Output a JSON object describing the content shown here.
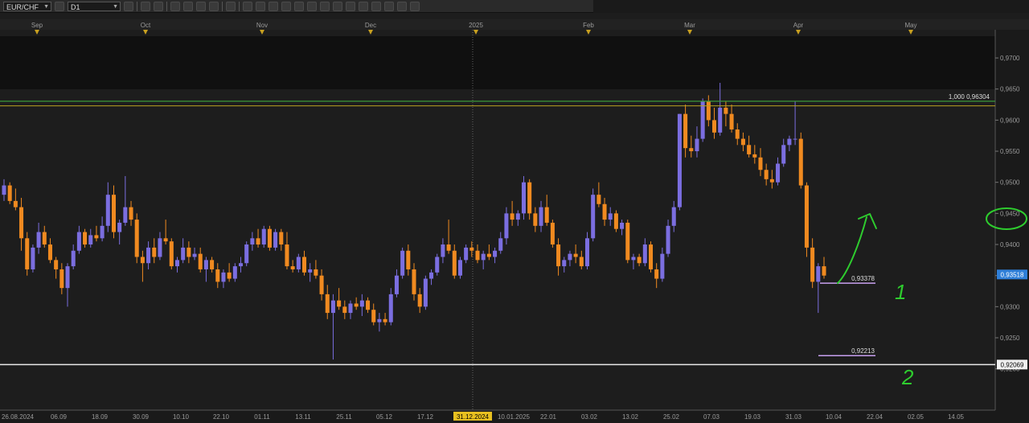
{
  "toolbar": {
    "symbol": "EUR/CHF",
    "timeframe": "D1",
    "buttons": [
      "chart-type",
      "indicators",
      "crosshair",
      "zoom-in",
      "zoom-out",
      "draw",
      "text",
      "shapes",
      "fib",
      "trend",
      "channel",
      "levels",
      "settings",
      "erase"
    ]
  },
  "chart_data": {
    "type": "candlestick",
    "instrument": "EUR/CHF",
    "timeframe": "D1",
    "y_range": [
      0.9175,
      0.9735
    ],
    "price_ticks": [
      "0,9700",
      "0,9650",
      "0,9600",
      "0,9550",
      "0,9500",
      "0,9450",
      "0,9400",
      "0,9350",
      "0,9300",
      "0,9250",
      "0,9200"
    ],
    "month_labels": [
      "Sep",
      "Oct",
      "Nov",
      "Dec",
      "2025",
      "Feb",
      "Mar",
      "Apr",
      "May"
    ],
    "date_labels": [
      "26.08.2024",
      "06.09",
      "18.09",
      "30.09",
      "10.10",
      "22.10",
      "01.11",
      "13.11",
      "25.11",
      "05.12",
      "17.12",
      "31.12.2024",
      "10.01.2025",
      "22.01",
      "03.02",
      "13.02",
      "25.02",
      "07.03",
      "19.03",
      "31.03",
      "10.04",
      "22.04",
      "02.05",
      "14.05"
    ],
    "current_date_label": "31.12.2024",
    "current_price": "0,93518",
    "levels": [
      {
        "label": "1,000 0,96304",
        "value": 0.96304,
        "color": "#3a9a3a"
      },
      {
        "label": "0,92069",
        "value": 0.92069,
        "color": "#e8e8e8"
      }
    ],
    "ochl_note": "candles: [open, high, low, close]",
    "candles": [
      [
        0.948,
        0.9505,
        0.947,
        0.9495
      ],
      [
        0.9495,
        0.95,
        0.9465,
        0.947
      ],
      [
        0.947,
        0.949,
        0.9455,
        0.946
      ],
      [
        0.946,
        0.9475,
        0.939,
        0.941
      ],
      [
        0.941,
        0.942,
        0.935,
        0.936
      ],
      [
        0.936,
        0.94,
        0.9355,
        0.9395
      ],
      [
        0.9395,
        0.9435,
        0.9385,
        0.942
      ],
      [
        0.942,
        0.943,
        0.9395,
        0.94
      ],
      [
        0.94,
        0.941,
        0.937,
        0.9375
      ],
      [
        0.9375,
        0.938,
        0.9345,
        0.936
      ],
      [
        0.936,
        0.937,
        0.932,
        0.933
      ],
      [
        0.933,
        0.937,
        0.93,
        0.9365
      ],
      [
        0.9365,
        0.94,
        0.936,
        0.939
      ],
      [
        0.939,
        0.943,
        0.9385,
        0.942
      ],
      [
        0.942,
        0.9425,
        0.9395,
        0.94
      ],
      [
        0.94,
        0.9425,
        0.9395,
        0.9415
      ],
      [
        0.9415,
        0.943,
        0.9405,
        0.941
      ],
      [
        0.941,
        0.9445,
        0.9405,
        0.943
      ],
      [
        0.943,
        0.95,
        0.942,
        0.948
      ],
      [
        0.948,
        0.9495,
        0.941,
        0.942
      ],
      [
        0.942,
        0.944,
        0.94,
        0.9435
      ],
      [
        0.9435,
        0.951,
        0.943,
        0.946
      ],
      [
        0.946,
        0.947,
        0.943,
        0.944
      ],
      [
        0.944,
        0.945,
        0.937,
        0.938
      ],
      [
        0.938,
        0.939,
        0.934,
        0.937
      ],
      [
        0.937,
        0.9405,
        0.936,
        0.9395
      ],
      [
        0.9395,
        0.941,
        0.937,
        0.938
      ],
      [
        0.938,
        0.942,
        0.9375,
        0.941
      ],
      [
        0.941,
        0.944,
        0.94,
        0.9405
      ],
      [
        0.9405,
        0.941,
        0.936,
        0.9365
      ],
      [
        0.9365,
        0.938,
        0.9355,
        0.9375
      ],
      [
        0.9375,
        0.941,
        0.937,
        0.9395
      ],
      [
        0.9395,
        0.9405,
        0.937,
        0.938
      ],
      [
        0.938,
        0.9395,
        0.9375,
        0.9385
      ],
      [
        0.9385,
        0.9395,
        0.9355,
        0.936
      ],
      [
        0.936,
        0.938,
        0.934,
        0.9375
      ],
      [
        0.9375,
        0.938,
        0.9355,
        0.936
      ],
      [
        0.936,
        0.937,
        0.933,
        0.934
      ],
      [
        0.934,
        0.936,
        0.933,
        0.9355
      ],
      [
        0.9355,
        0.937,
        0.934,
        0.9345
      ],
      [
        0.9345,
        0.937,
        0.934,
        0.9365
      ],
      [
        0.9365,
        0.938,
        0.9355,
        0.937
      ],
      [
        0.937,
        0.9405,
        0.9365,
        0.94
      ],
      [
        0.94,
        0.942,
        0.939,
        0.941
      ],
      [
        0.941,
        0.9425,
        0.9395,
        0.94
      ],
      [
        0.94,
        0.943,
        0.9395,
        0.9425
      ],
      [
        0.9425,
        0.943,
        0.939,
        0.9395
      ],
      [
        0.9395,
        0.9425,
        0.939,
        0.942
      ],
      [
        0.942,
        0.9425,
        0.939,
        0.94
      ],
      [
        0.94,
        0.942,
        0.936,
        0.9365
      ],
      [
        0.9365,
        0.9375,
        0.9355,
        0.936
      ],
      [
        0.936,
        0.9385,
        0.9355,
        0.938
      ],
      [
        0.938,
        0.939,
        0.935,
        0.9355
      ],
      [
        0.9355,
        0.937,
        0.934,
        0.936
      ],
      [
        0.936,
        0.9375,
        0.9345,
        0.935
      ],
      [
        0.935,
        0.936,
        0.931,
        0.932
      ],
      [
        0.932,
        0.9335,
        0.928,
        0.929
      ],
      [
        0.929,
        0.932,
        0.9215,
        0.931
      ],
      [
        0.931,
        0.933,
        0.9295,
        0.93
      ],
      [
        0.93,
        0.931,
        0.928,
        0.929
      ],
      [
        0.929,
        0.931,
        0.928,
        0.9305
      ],
      [
        0.9305,
        0.9315,
        0.9295,
        0.93
      ],
      [
        0.93,
        0.932,
        0.9285,
        0.931
      ],
      [
        0.931,
        0.9315,
        0.929,
        0.9295
      ],
      [
        0.9295,
        0.9305,
        0.927,
        0.9275
      ],
      [
        0.9275,
        0.929,
        0.926,
        0.928
      ],
      [
        0.928,
        0.929,
        0.927,
        0.9275
      ],
      [
        0.9275,
        0.933,
        0.927,
        0.932
      ],
      [
        0.932,
        0.936,
        0.9315,
        0.935
      ],
      [
        0.935,
        0.9395,
        0.9345,
        0.939
      ],
      [
        0.939,
        0.94,
        0.935,
        0.936
      ],
      [
        0.936,
        0.937,
        0.931,
        0.932
      ],
      [
        0.932,
        0.933,
        0.929,
        0.93
      ],
      [
        0.93,
        0.935,
        0.9295,
        0.9345
      ],
      [
        0.9345,
        0.936,
        0.9335,
        0.9355
      ],
      [
        0.9355,
        0.9385,
        0.935,
        0.938
      ],
      [
        0.938,
        0.941,
        0.937,
        0.94
      ],
      [
        0.94,
        0.944,
        0.9385,
        0.939
      ],
      [
        0.939,
        0.94,
        0.9345,
        0.935
      ],
      [
        0.935,
        0.938,
        0.9345,
        0.9375
      ],
      [
        0.9375,
        0.94,
        0.937,
        0.9395
      ],
      [
        0.9395,
        0.9405,
        0.938,
        0.939
      ],
      [
        0.939,
        0.94,
        0.937,
        0.9375
      ],
      [
        0.9375,
        0.939,
        0.936,
        0.9385
      ],
      [
        0.9385,
        0.94,
        0.9375,
        0.938
      ],
      [
        0.938,
        0.9395,
        0.937,
        0.939
      ],
      [
        0.939,
        0.942,
        0.9385,
        0.941
      ],
      [
        0.941,
        0.946,
        0.94,
        0.945
      ],
      [
        0.945,
        0.947,
        0.943,
        0.944
      ],
      [
        0.944,
        0.9455,
        0.943,
        0.945
      ],
      [
        0.945,
        0.951,
        0.944,
        0.95
      ],
      [
        0.95,
        0.9505,
        0.944,
        0.945
      ],
      [
        0.945,
        0.946,
        0.942,
        0.943
      ],
      [
        0.943,
        0.947,
        0.942,
        0.946
      ],
      [
        0.946,
        0.948,
        0.943,
        0.9435
      ],
      [
        0.9435,
        0.944,
        0.9395,
        0.94
      ],
      [
        0.94,
        0.941,
        0.935,
        0.9365
      ],
      [
        0.9365,
        0.938,
        0.9355,
        0.9375
      ],
      [
        0.9375,
        0.939,
        0.9365,
        0.9385
      ],
      [
        0.9385,
        0.94,
        0.937,
        0.938
      ],
      [
        0.938,
        0.939,
        0.936,
        0.9365
      ],
      [
        0.9365,
        0.942,
        0.936,
        0.941
      ],
      [
        0.941,
        0.949,
        0.9405,
        0.948
      ],
      [
        0.948,
        0.95,
        0.946,
        0.9465
      ],
      [
        0.9465,
        0.9475,
        0.943,
        0.944
      ],
      [
        0.944,
        0.946,
        0.943,
        0.945
      ],
      [
        0.945,
        0.9455,
        0.942,
        0.9425
      ],
      [
        0.9425,
        0.944,
        0.9415,
        0.9435
      ],
      [
        0.9435,
        0.944,
        0.937,
        0.9375
      ],
      [
        0.9375,
        0.9385,
        0.936,
        0.938
      ],
      [
        0.938,
        0.9385,
        0.9365,
        0.937
      ],
      [
        0.937,
        0.941,
        0.9365,
        0.94
      ],
      [
        0.94,
        0.9405,
        0.9355,
        0.936
      ],
      [
        0.936,
        0.937,
        0.933,
        0.9345
      ],
      [
        0.9345,
        0.9395,
        0.934,
        0.9385
      ],
      [
        0.9385,
        0.944,
        0.938,
        0.943
      ],
      [
        0.943,
        0.947,
        0.942,
        0.946
      ],
      [
        0.946,
        0.961,
        0.9455,
        0.961
      ],
      [
        0.961,
        0.9625,
        0.954,
        0.9555
      ],
      [
        0.9555,
        0.9575,
        0.954,
        0.955
      ],
      [
        0.955,
        0.959,
        0.954,
        0.957
      ],
      [
        0.957,
        0.9635,
        0.9565,
        0.963
      ],
      [
        0.963,
        0.964,
        0.959,
        0.96
      ],
      [
        0.96,
        0.962,
        0.957,
        0.958
      ],
      [
        0.958,
        0.966,
        0.9575,
        0.962
      ],
      [
        0.962,
        0.963,
        0.959,
        0.961
      ],
      [
        0.961,
        0.9625,
        0.958,
        0.9585
      ],
      [
        0.9585,
        0.9595,
        0.956,
        0.957
      ],
      [
        0.957,
        0.958,
        0.955,
        0.956
      ],
      [
        0.956,
        0.9575,
        0.954,
        0.9545
      ],
      [
        0.9545,
        0.956,
        0.953,
        0.954
      ],
      [
        0.954,
        0.9555,
        0.951,
        0.952
      ],
      [
        0.952,
        0.953,
        0.9495,
        0.9505
      ],
      [
        0.9505,
        0.952,
        0.949,
        0.95
      ],
      [
        0.95,
        0.954,
        0.9495,
        0.953
      ],
      [
        0.953,
        0.957,
        0.9525,
        0.956
      ],
      [
        0.956,
        0.9575,
        0.955,
        0.957
      ],
      [
        0.957,
        0.963,
        0.956,
        0.957
      ],
      [
        0.957,
        0.958,
        0.949,
        0.9495
      ],
      [
        0.9495,
        0.95,
        0.938,
        0.9395
      ],
      [
        0.9395,
        0.941,
        0.933,
        0.934
      ],
      [
        0.934,
        0.937,
        0.929,
        0.9365
      ],
      [
        0.9365,
        0.938,
        0.9345,
        0.935
      ]
    ]
  },
  "annotations": {
    "level_1": {
      "label": "0,93378",
      "marker": "1"
    },
    "level_2": {
      "label": "0,92213",
      "marker": "2"
    }
  }
}
